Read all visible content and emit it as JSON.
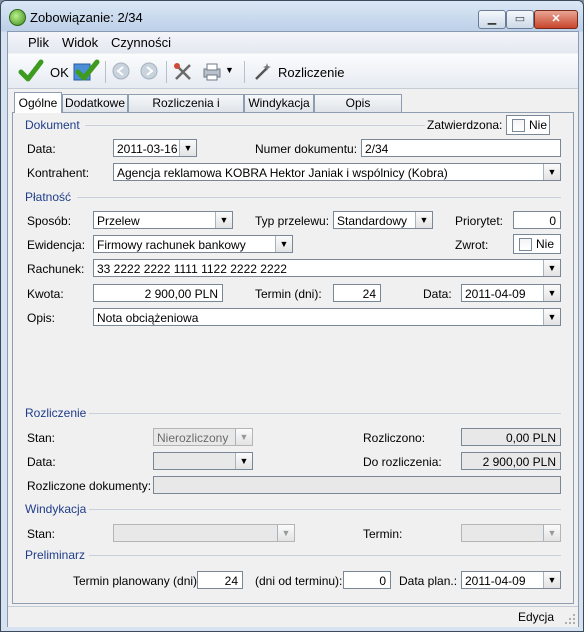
{
  "window": {
    "title": "Zobowiązanie: 2/34"
  },
  "menu": [
    "Plik",
    "Widok",
    "Czynności"
  ],
  "toolbar": {
    "ok_label": "OK",
    "settle_label": "Rozliczenie"
  },
  "tabs": [
    "Ogólne",
    "Dodatkowe",
    "Rozliczenia i Przelewy",
    "Windykacja",
    "Opis analityczny"
  ],
  "dokument": {
    "section": "Dokument",
    "zatwierdzona_label": "Zatwierdzona:",
    "zatwierdzona_value": "Nie",
    "data_label": "Data:",
    "data_value": "2011-03-16",
    "numer_label": "Numer dokumentu:",
    "numer_value": "2/34",
    "kontrahent_label": "Kontrahent:",
    "kontrahent_value": "Agencja reklamowa KOBRA Hektor Janiak i wspólnicy (Kobra)"
  },
  "platnosc": {
    "section": "Płatność",
    "sposob_label": "Sposób:",
    "sposob_value": "Przelew",
    "typ_label": "Typ przelewu:",
    "typ_value": "Standardowy",
    "priorytet_label": "Priorytet:",
    "priorytet_value": "0",
    "ewidencja_label": "Ewidencja:",
    "ewidencja_value": "Firmowy rachunek bankowy",
    "zwrot_label": "Zwrot:",
    "zwrot_value": "Nie",
    "rachunek_label": "Rachunek:",
    "rachunek_value": "33 2222 2222 1111 1122 2222 2222",
    "kwota_label": "Kwota:",
    "kwota_value": "2 900,00 PLN",
    "termin_label": "Termin (dni):",
    "termin_value": "24",
    "data_label": "Data:",
    "data_value": "2011-04-09",
    "opis_label": "Opis:",
    "opis_value": "Nota obciążeniowa"
  },
  "rozliczenie": {
    "section": "Rozliczenie",
    "stan_label": "Stan:",
    "stan_value": "Nierozliczony",
    "rozliczono_label": "Rozliczono:",
    "rozliczono_value": "0,00 PLN",
    "data_label": "Data:",
    "data_value": "",
    "do_rozliczenia_label": "Do rozliczenia:",
    "do_rozliczenia_value": "2 900,00 PLN",
    "dokumenty_label": "Rozliczone dokumenty:",
    "dokumenty_value": ""
  },
  "windykacja": {
    "section": "Windykacja",
    "stan_label": "Stan:",
    "stan_value": "",
    "termin_label": "Termin:",
    "termin_value": ""
  },
  "preliminarz": {
    "section": "Preliminarz",
    "termin_planowany_label": "Termin planowany (dni):",
    "termin_planowany_value": "24",
    "dni_od_terminu_label": "(dni od terminu):",
    "dni_od_terminu_value": "0",
    "data_plan_label": "Data plan.:",
    "data_plan_value": "2011-04-09"
  },
  "status": {
    "mode": "Edycja"
  },
  "colors": {
    "section_title": "#1f3d8a",
    "titlebar": "#bcd0e8",
    "close_button": "#c8452c"
  },
  "icons": [
    "app-icon",
    "ok-check-icon",
    "check-save-icon",
    "back-arrow-icon",
    "forward-arrow-icon",
    "tools-icon",
    "print-icon",
    "wand-icon"
  ]
}
